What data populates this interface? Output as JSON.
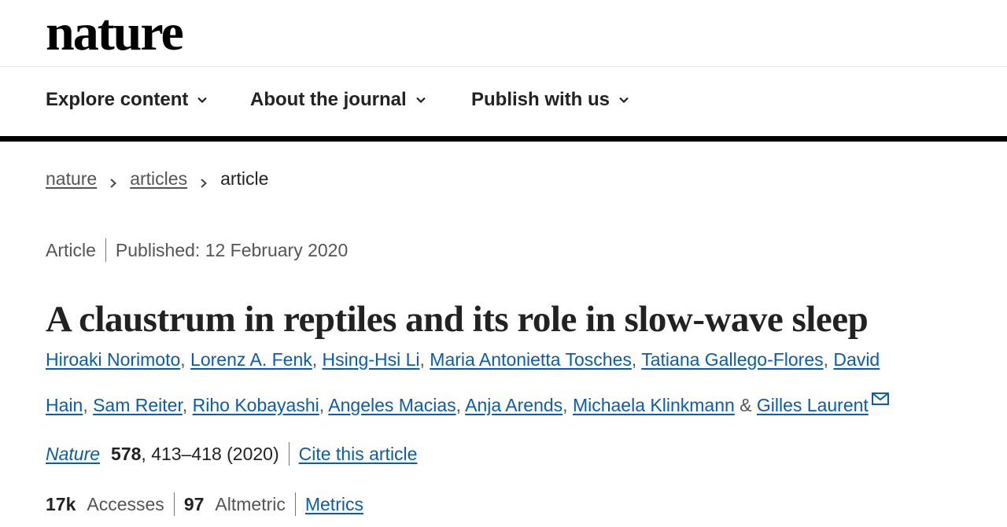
{
  "brand": {
    "logo_text": "nature"
  },
  "nav": {
    "items": [
      {
        "label": "Explore content"
      },
      {
        "label": "About the journal"
      },
      {
        "label": "Publish with us"
      }
    ],
    "chevron_icon": "chevron-down-icon"
  },
  "breadcrumb": {
    "items": [
      {
        "label": "nature",
        "link": true
      },
      {
        "label": "articles",
        "link": true
      },
      {
        "label": "article",
        "link": false
      }
    ]
  },
  "article": {
    "type": "Article",
    "published": "Published: 12 February 2020",
    "title": "A claustrum in reptiles and its role in slow-wave sleep",
    "authors": [
      "Hiroaki Norimoto",
      "Lorenz A. Fenk",
      "Hsing-Hsi Li",
      "Maria Antonietta Tosches",
      "Tatiana Gallego-Flores",
      "David",
      "Hain",
      "Sam Reiter",
      "Riho Kobayashi",
      "Angeles Macias",
      "Anja Arends",
      "Michaela Klinkmann",
      "Gilles Laurent"
    ],
    "author_separator": ",",
    "author_conjunction": "&",
    "corresponding_icon": "envelope-icon"
  },
  "citation": {
    "journal": "Nature",
    "volume": "578",
    "pages_year": ", 413–418 (2020)",
    "cite_label": "Cite this article"
  },
  "metrics": {
    "accesses_count": "17k",
    "accesses_label": "Accesses",
    "altmetric_count": "97",
    "altmetric_label": "Altmetric",
    "metrics_link": "Metrics"
  },
  "colors": {
    "link": "#0a5cad",
    "rule": "#000000",
    "muted_text": "#555555"
  }
}
